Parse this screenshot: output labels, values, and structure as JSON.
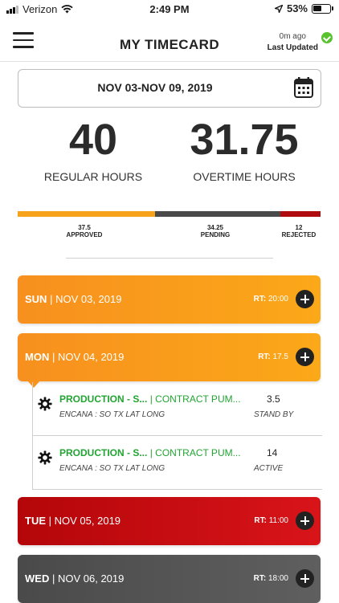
{
  "status_bar": {
    "carrier": "Verizon",
    "time": "2:49 PM",
    "battery": "53%",
    "battery_level": 0.53,
    "icons": [
      "signal-icon",
      "wifi-icon",
      "location-arrow-icon",
      "battery-icon"
    ]
  },
  "header": {
    "title": "MY TIMECARD",
    "updated_ago": "0m ago",
    "updated_label": "Last Updated",
    "menu_icon": "hamburger-icon",
    "status_icon": "check-circle-icon"
  },
  "date_range": {
    "label": "NOV 03-NOV 09, 2019",
    "icon": "calendar-icon"
  },
  "summary": {
    "regular": {
      "value": "40",
      "label": "REGULAR HOURS"
    },
    "overtime": {
      "value": "31.75",
      "label": "OVERTIME HOURS"
    }
  },
  "progress": {
    "approved": {
      "value": "37.5",
      "label": "APPROVED",
      "fraction": 0.453,
      "color": "#f7a21b"
    },
    "pending": {
      "value": "34.25",
      "label": "PENDING",
      "fraction": 0.414,
      "color": "#4a4a4a"
    },
    "rejected": {
      "value": "12",
      "label": "REJECTED",
      "fraction": 0.133,
      "color": "#b00b0e"
    }
  },
  "days": [
    {
      "day": "SUN",
      "date": "NOV 03, 2019",
      "rt_label": "RT:",
      "rt_value": "20:00",
      "color": "orange"
    },
    {
      "day": "MON",
      "date": "NOV 04, 2019",
      "rt_label": "RT:",
      "rt_value": "17.5",
      "color": "orange",
      "expanded": true
    },
    {
      "day": "TUE",
      "date": "NOV 05, 2019",
      "rt_label": "RT:",
      "rt_value": "11:00",
      "color": "red"
    },
    {
      "day": "WED",
      "date": "NOV 06, 2019",
      "rt_label": "RT:",
      "rt_value": "18:00",
      "color": "grey"
    }
  ],
  "separator": "|",
  "entries": [
    {
      "job": "PRODUCTION - S...",
      "sep": "|",
      "task": "CONTRACT PUM...",
      "client": "ENCANA : SO TX LAT LONG",
      "hours": "3.5",
      "status": "STAND BY"
    },
    {
      "job": "PRODUCTION - S...",
      "sep": "|",
      "task": "CONTRACT PUM...",
      "client": "ENCANA : SO TX LAT LONG",
      "hours": "14",
      "status": "ACTIVE"
    }
  ]
}
